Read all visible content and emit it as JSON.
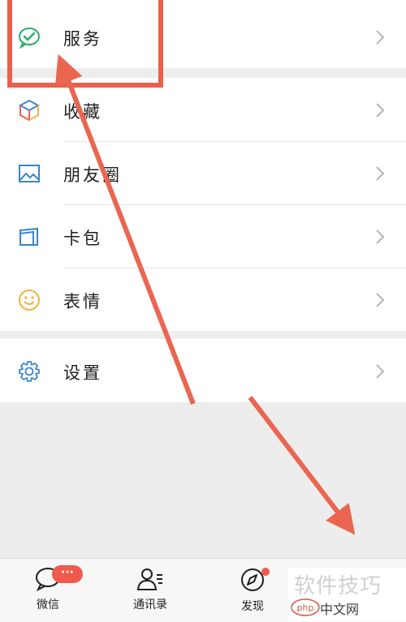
{
  "menu": {
    "services_label": "服务",
    "favorites_label": "收藏",
    "moments_label": "朋友圈",
    "cards_label": "卡包",
    "stickers_label": "表情",
    "settings_label": "设置"
  },
  "tabbar": {
    "chats_label": "微信",
    "chats_badge": "···",
    "contacts_label": "通讯录",
    "discover_label": "发现"
  },
  "watermark": {
    "main_text": "软件技巧",
    "logo_text": "php",
    "sub_text": "中文网"
  },
  "colors": {
    "highlight": "#e8604c",
    "arrow": "#ea6651",
    "badge": "#f05a4c",
    "service_icon": "#2aae67",
    "line_icon": "#3a86c8",
    "sticker_icon": "#f0b53c"
  }
}
